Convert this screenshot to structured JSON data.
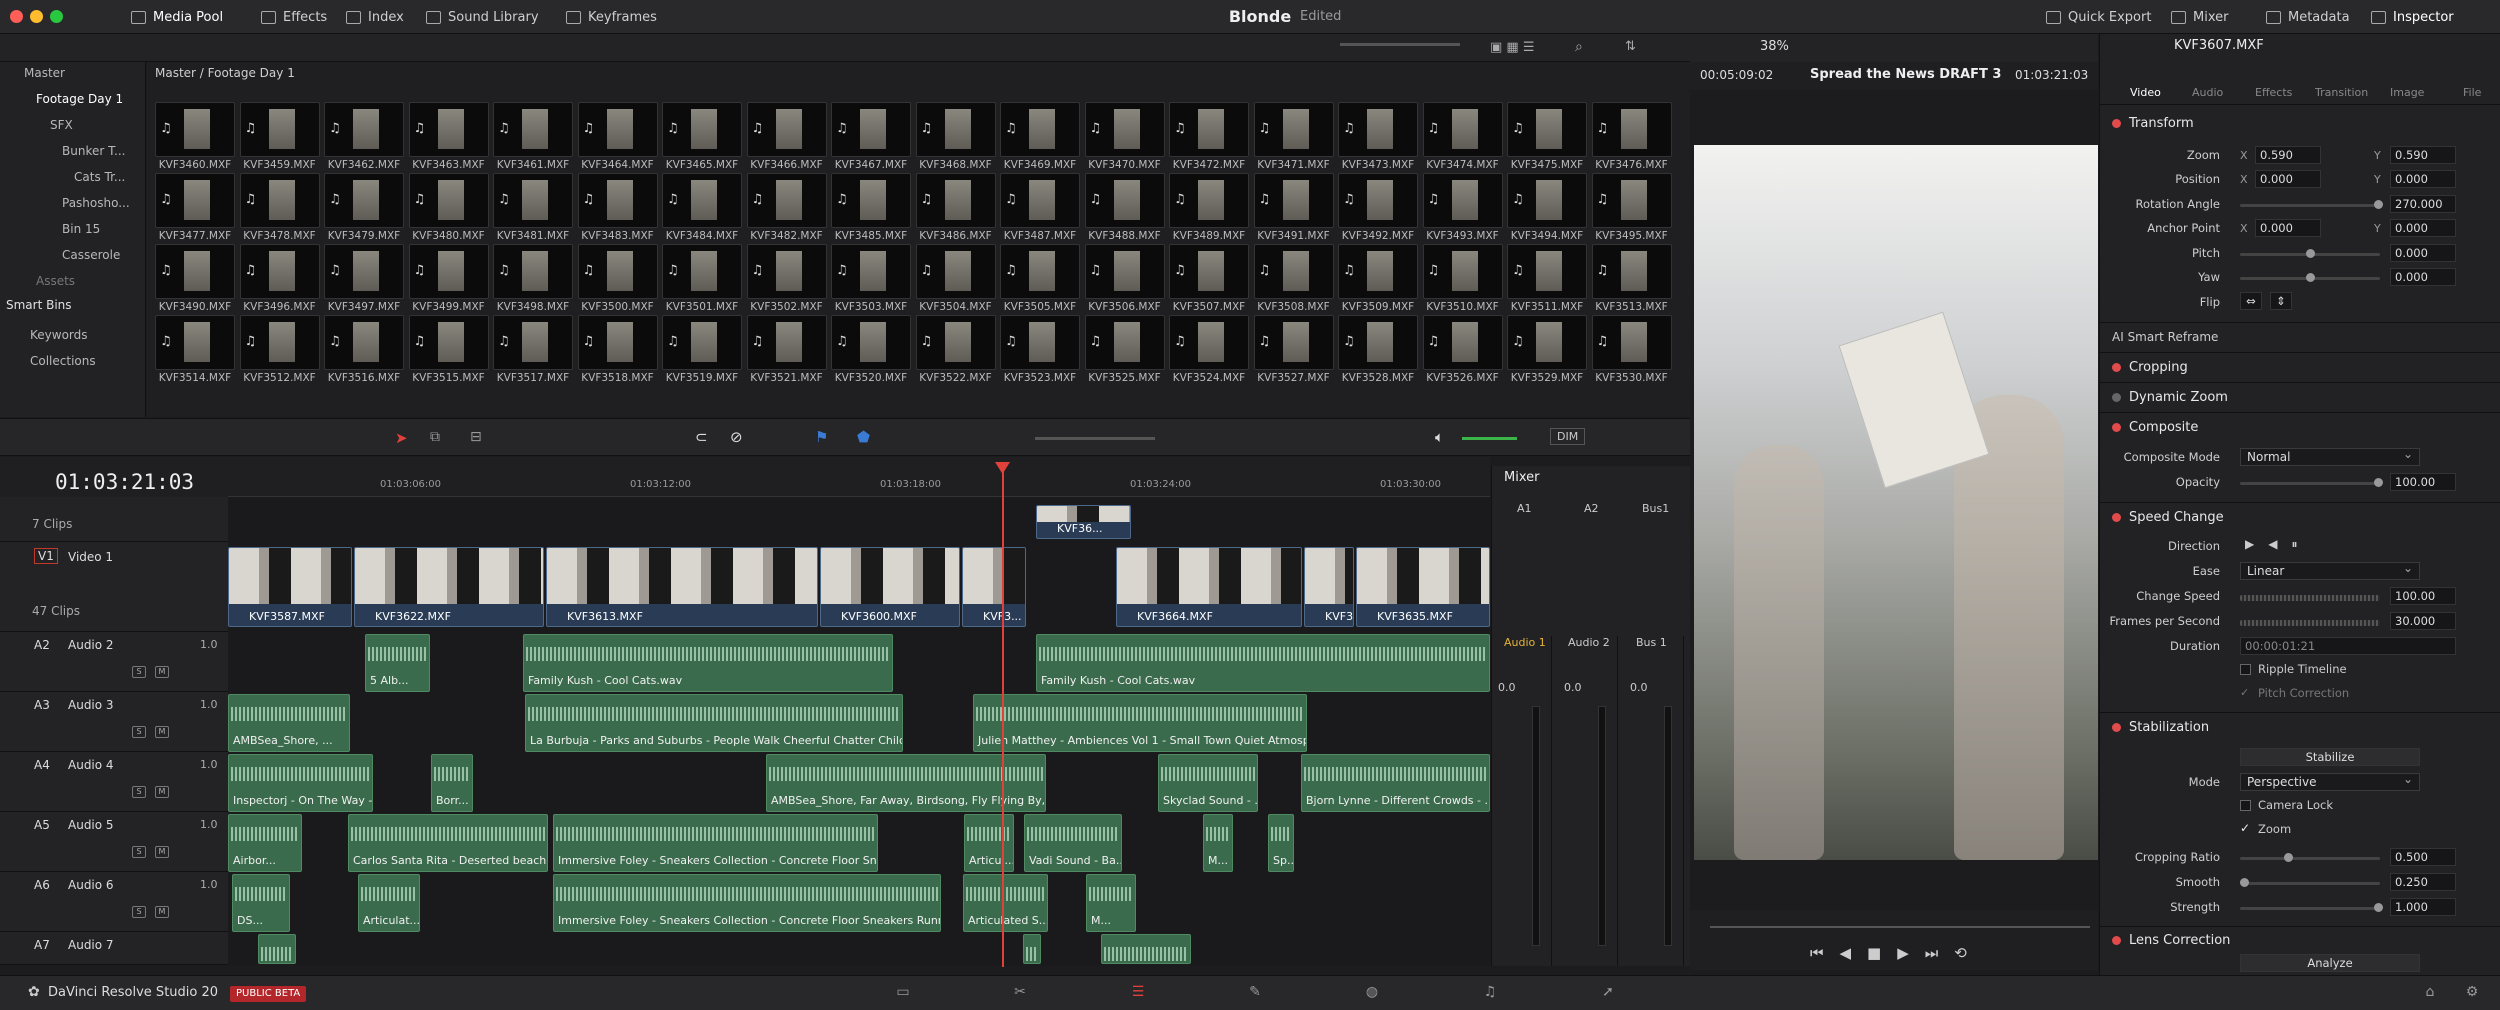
{
  "topbar": {
    "tabs": [
      {
        "label": "Media Pool",
        "icon": "media-pool-icon"
      },
      {
        "label": "Effects",
        "icon": "effects-icon"
      },
      {
        "label": "Index",
        "icon": "index-icon"
      },
      {
        "label": "Sound Library",
        "icon": "sound-library-icon"
      },
      {
        "label": "Keyframes",
        "icon": "keyframes-icon"
      }
    ],
    "project_title": "Blonde",
    "project_status": "Edited",
    "right_tabs": [
      {
        "label": "Quick Export"
      },
      {
        "label": "Mixer"
      },
      {
        "label": "Metadata"
      },
      {
        "label": "Inspector"
      }
    ]
  },
  "media_pool": {
    "path": "Master / Footage Day 1",
    "sidebar": {
      "items": [
        "Master",
        "Footage Day 1",
        "SFX",
        "Bunker T...",
        "Cats Tr...",
        "Pashosho...",
        "Bin 15",
        "Casserole",
        "Assets"
      ],
      "smart_bins_title": "Smart Bins",
      "smart_items": [
        "Keywords",
        "Collections"
      ]
    },
    "clips": [
      "KVF3460.MXF",
      "KVF3459.MXF",
      "KVF3462.MXF",
      "KVF3463.MXF",
      "KVF3461.MXF",
      "KVF3464.MXF",
      "KVF3465.MXF",
      "KVF3466.MXF",
      "KVF3467.MXF",
      "KVF3468.MXF",
      "KVF3469.MXF",
      "KVF3470.MXF",
      "KVF3472.MXF",
      "KVF3471.MXF",
      "KVF3473.MXF",
      "KVF3474.MXF",
      "KVF3475.MXF",
      "KVF3476.MXF",
      "KVF3477.MXF",
      "KVF3478.MXF",
      "KVF3479.MXF",
      "KVF3480.MXF",
      "KVF3481.MXF",
      "KVF3483.MXF",
      "KVF3484.MXF",
      "KVF3482.MXF",
      "KVF3485.MXF",
      "KVF3486.MXF",
      "KVF3487.MXF",
      "KVF3488.MXF",
      "KVF3489.MXF",
      "KVF3491.MXF",
      "KVF3492.MXF",
      "KVF3493.MXF",
      "KVF3494.MXF",
      "KVF3495.MXF",
      "KVF3490.MXF",
      "KVF3496.MXF",
      "KVF3497.MXF",
      "KVF3499.MXF",
      "KVF3498.MXF",
      "KVF3500.MXF",
      "KVF3501.MXF",
      "KVF3502.MXF",
      "KVF3503.MXF",
      "KVF3504.MXF",
      "KVF3505.MXF",
      "KVF3506.MXF",
      "KVF3507.MXF",
      "KVF3508.MXF",
      "KVF3509.MXF",
      "KVF3510.MXF",
      "KVF3511.MXF",
      "KVF3513.MXF",
      "KVF3514.MXF",
      "KVF3512.MXF",
      "KVF3516.MXF",
      "KVF3515.MXF",
      "KVF3517.MXF",
      "KVF3518.MXF",
      "KVF3519.MXF",
      "KVF3521.MXF",
      "KVF3520.MXF",
      "KVF3522.MXF",
      "KVF3523.MXF",
      "KVF3525.MXF",
      "KVF3524.MXF",
      "KVF3527.MXF",
      "KVF3528.MXF",
      "KVF3526.MXF",
      "KVF3529.MXF",
      "KVF3530.MXF"
    ]
  },
  "timeline": {
    "timecode": "01:03:21:03",
    "ruler": [
      "01:03:06:00",
      "01:03:12:00",
      "01:03:18:00",
      "01:03:24:00",
      "01:03:30:00"
    ],
    "dim_label": "DIM",
    "tracks": [
      {
        "id": "",
        "name": "7 Clips",
        "vol": ""
      },
      {
        "id": "V1",
        "name": "Video 1",
        "sub": "47 Clips",
        "vol": ""
      },
      {
        "id": "A2",
        "name": "Audio 2",
        "vol": "1.0"
      },
      {
        "id": "A3",
        "name": "Audio 3",
        "vol": "1.0"
      },
      {
        "id": "A4",
        "name": "Audio 4",
        "vol": "1.0"
      },
      {
        "id": "A5",
        "name": "Audio 5",
        "vol": "1.0"
      },
      {
        "id": "A6",
        "name": "Audio 6",
        "vol": "1.0"
      },
      {
        "id": "A7",
        "name": "Audio 7",
        "vol": ""
      }
    ],
    "video_clips": [
      "KVF3587.MXF",
      "KVF3622.MXF",
      "KVF3613.MXF",
      "KVF3600.MXF",
      "KVF3...",
      "KVF3664.MXF",
      "KVF36...",
      "KVF3635.MXF",
      "KVF36..."
    ],
    "audio_clips": {
      "a2": [
        "5 Alb...",
        "Family Kush - Cool Cats.wav",
        "Family Kush - Cool Cats.wav"
      ],
      "a3": [
        "AMBSea_Shore, ...",
        "La Burbuja  - Parks and Suburbs - People Walk Cheerful Chatter Childre...",
        "Julien Matthey - Ambiences Vol 1 - Small Town Quiet Atmosphe..."
      ],
      "a4": [
        "Inspectorj - On The Way - ...",
        "Borr...",
        "AMBSea_Shore, Far Away, Birdsong, Fly Flying By, B...",
        "Skyclad Sound - ...",
        "Bjorn Lynne - Different Crowds - ..."
      ],
      "a5": [
        "Airbor...",
        "Carlos Santa Rita - Deserted beach - ...",
        "Immersive Foley - Sneakers Collection - Concrete Floor Sneaker...",
        "Articul...",
        "Vadi Sound - Ba...",
        "M...",
        "Sp..."
      ],
      "a6": [
        "DS...",
        "Articulat...",
        "Immersive Foley - Sneakers Collection - Concrete Floor Sneakers Running....",
        "Articulated S...",
        "M..."
      ]
    }
  },
  "mixer": {
    "title": "Mixer",
    "channels": [
      "A1",
      "A2",
      "Bus1"
    ],
    "strip_names": [
      "Audio 1",
      "Audio 2",
      "Bus 1"
    ],
    "levels": [
      "0.0",
      "0.0",
      "0.0"
    ]
  },
  "viewer": {
    "zoom": "38%",
    "left_tc": "00:05:09:02",
    "timeline_name": "Spread the News DRAFT 3",
    "right_tc": "01:03:21:03"
  },
  "inspector": {
    "clip_name": "KVF3607.MXF",
    "tabs": [
      "Video",
      "Audio",
      "Effects",
      "Transition",
      "Image",
      "File"
    ],
    "transform": {
      "title": "Transform",
      "zoom_x": "0.590",
      "zoom_y": "0.590",
      "pos_x": "0.000",
      "pos_y": "0.000",
      "rotation": "270.000",
      "anchor_x": "0.000",
      "anchor_y": "0.000",
      "pitch": "0.000",
      "yaw": "0.000",
      "labels": [
        "Zoom",
        "Position",
        "Rotation Angle",
        "Anchor Point",
        "Pitch",
        "Yaw",
        "Flip"
      ]
    },
    "ai_reframe": "AI Smart Reframe",
    "cropping": "Cropping",
    "dynamic_zoom": "Dynamic Zoom",
    "composite": {
      "title": "Composite",
      "mode_label": "Composite Mode",
      "mode": "Normal",
      "opacity_label": "Opacity",
      "opacity": "100.00"
    },
    "speed": {
      "title": "Speed Change",
      "direction_label": "Direction",
      "ease_label": "Ease",
      "ease": "Linear",
      "speed_label": "Change Speed",
      "speed": "100.00",
      "fps_label": "Frames per Second",
      "fps": "30.000",
      "duration_label": "Duration",
      "duration": "00:00:01:21",
      "ripple": "Ripple Timeline",
      "pitch": "Pitch Correction"
    },
    "stabilization": {
      "title": "Stabilization",
      "button": "Stabilize",
      "mode_label": "Mode",
      "mode": "Perspective",
      "camera_lock": "Camera Lock",
      "zoom": "Zoom",
      "crop_label": "Cropping Ratio",
      "crop": "0.500",
      "smooth_label": "Smooth",
      "smooth": "0.250",
      "strength_label": "Strength",
      "strength": "1.000"
    },
    "lens": {
      "title": "Lens Correction",
      "button": "Analyze"
    }
  },
  "bottombar": {
    "app_name": "DaVinci Resolve Studio 20",
    "badge": "PUBLIC BETA"
  }
}
